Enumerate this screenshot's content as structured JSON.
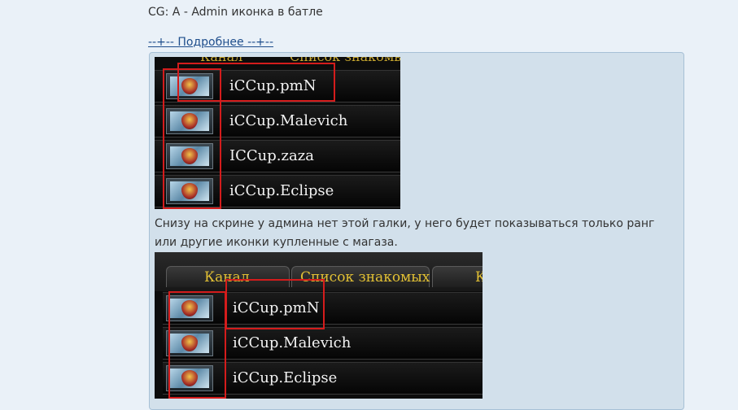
{
  "post": {
    "title": "CG: A - Admin иконка в батле",
    "more_link": "--+-- Подробнее --+--",
    "caption": "Снизу на скрине у админа нет этой галки, у него будет показываться только ранг или другие иконки купленные с магаза."
  },
  "screenshot1": {
    "tab_channel": "Канал",
    "tab_friends": "Список знакомых",
    "players": [
      "iCCup.pmN",
      "iCCup.Malevich",
      "ICCup.zaza",
      "iCCup.Eclipse"
    ]
  },
  "screenshot2": {
    "tab_channel": "Канал",
    "tab_friends": "Список знакомых",
    "tab_third": "К",
    "players": [
      "iCCup.pmN",
      "iCCup.Malevich",
      "iCCup.Eclipse"
    ]
  }
}
